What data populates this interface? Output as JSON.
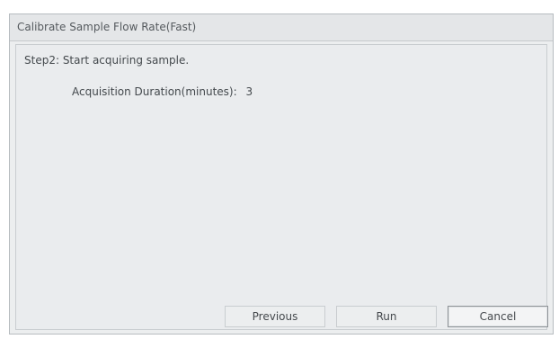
{
  "window": {
    "title": "Calibrate Sample Flow Rate(Fast)"
  },
  "content": {
    "step_text": "Step2: Start acquiring sample.",
    "duration_label": "Acquisition Duration(minutes):",
    "duration_value": "3"
  },
  "buttons": {
    "previous_label": "Previous",
    "run_label": "Run",
    "cancel_label": "Cancel"
  },
  "colors": {
    "window_background": "#eceeef",
    "content_background": "#eaecee",
    "border": "#c9cdd0"
  }
}
